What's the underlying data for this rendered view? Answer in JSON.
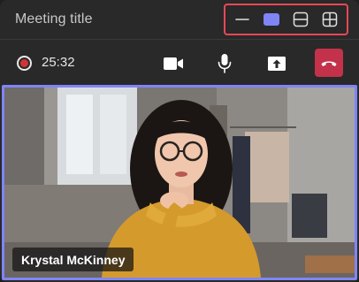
{
  "window": {
    "title": "Meeting title"
  },
  "view_controls": {
    "items": [
      {
        "icon": "minimize-icon"
      },
      {
        "icon": "full-view-icon",
        "selected": true
      },
      {
        "icon": "split-view-icon"
      },
      {
        "icon": "grid-view-icon"
      }
    ],
    "highlight_color": "#e74856",
    "selected_color": "#7f85f5"
  },
  "controls": {
    "timer": "25:32",
    "buttons": [
      {
        "icon": "camera-icon"
      },
      {
        "icon": "microphone-icon"
      },
      {
        "icon": "share-screen-icon"
      },
      {
        "icon": "hang-up-icon",
        "color": "#c4314b"
      }
    ]
  },
  "video": {
    "participant_name": "Krystal McKinney",
    "border_color": "#7f85f5"
  }
}
